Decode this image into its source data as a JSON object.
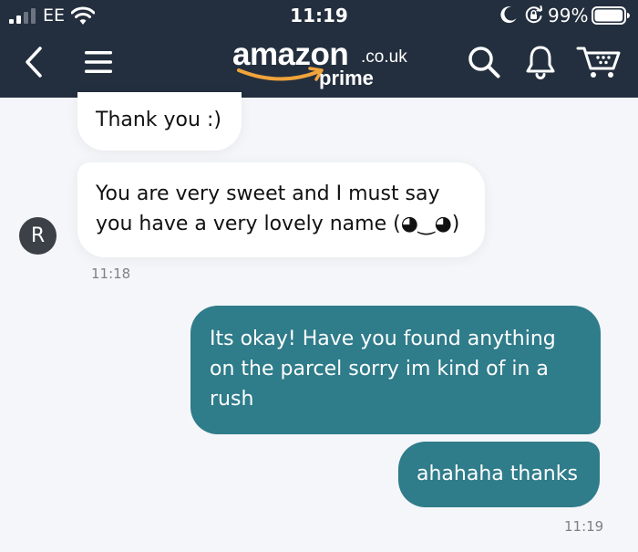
{
  "status_bar": {
    "carrier": "EE",
    "time": "11:19",
    "battery_percent": "99%",
    "battery_level": 0.99,
    "icons": [
      "signal-icon",
      "wifi-icon",
      "moon-icon",
      "rotation-lock-icon",
      "battery-icon"
    ]
  },
  "nav": {
    "logo_text": "amazon",
    "logo_domain": ".co.uk",
    "logo_sub": "prime",
    "icons": [
      "back-icon",
      "menu-icon",
      "search-icon",
      "bell-icon",
      "cart-icon"
    ]
  },
  "chat": {
    "avatar_initial": "R",
    "messages": [
      {
        "from": "them",
        "text": "Thank you :)"
      },
      {
        "from": "them",
        "text": "You are very sweet and I must say\nyou have a very lovely name (◕‿◕)",
        "time": "11:18"
      },
      {
        "from": "me",
        "text": "Its okay! Have you found anything\non the parcel sorry im kind of in a\nrush"
      },
      {
        "from": "me",
        "text": "ahahaha thanks",
        "time": "11:19"
      }
    ]
  },
  "colors": {
    "header_bg": "#232f3e",
    "outgoing_bubble": "#2f7c8a",
    "incoming_bubble": "#ffffff",
    "logo_smile": "#f0a43b",
    "page_bg": "#f4f6f9"
  }
}
